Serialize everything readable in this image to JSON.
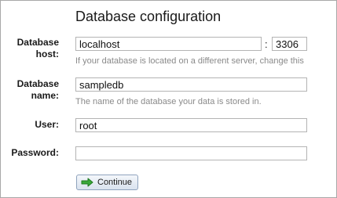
{
  "form": {
    "title": "Database configuration",
    "host": {
      "label_line1": "Database",
      "label_line2": "host:",
      "value": "localhost",
      "port_separator": ":",
      "port_value": "3306",
      "hint": "If your database is located on a different server, change this"
    },
    "name": {
      "label_line1": "Database",
      "label_line2": "name:",
      "value": "sampledb",
      "hint": "The name of the database your data is stored in."
    },
    "user": {
      "label": "User:",
      "value": "root"
    },
    "password": {
      "label": "Password:",
      "value": ""
    },
    "continue_label": "Continue",
    "continue_icon": "arrow-right-icon",
    "accent_color": "#3aa83a"
  }
}
